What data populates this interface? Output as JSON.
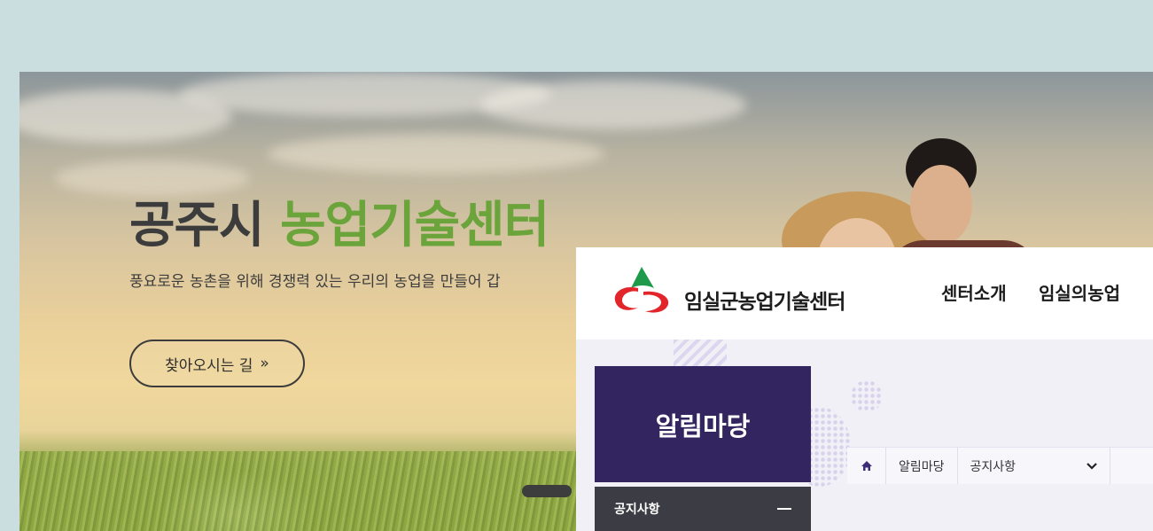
{
  "hero": {
    "title_part1": "공주시",
    "title_part2": "농업기술센터",
    "subtitle": "풍요로운 농촌을 위해 경쟁력 있는 우리의 농업을 만들어 갑",
    "directions_button": "찾아오시는 길",
    "directions_arrow": "»"
  },
  "overlay": {
    "logo_text": "임실군농업기술센터",
    "nav": [
      "센터소개",
      "임실의농업"
    ],
    "sidebar_title": "알림마당",
    "sidebar_menu_item": "공지사항",
    "breadcrumb": {
      "section": "알림마당",
      "current": "공지사항"
    }
  },
  "colors": {
    "page_bg": "#cbdedf",
    "hero_title_green": "#6aa43a",
    "sidebar_purple": "#33255f",
    "logo_red": "#e2252b",
    "logo_green": "#1e9a4a"
  }
}
